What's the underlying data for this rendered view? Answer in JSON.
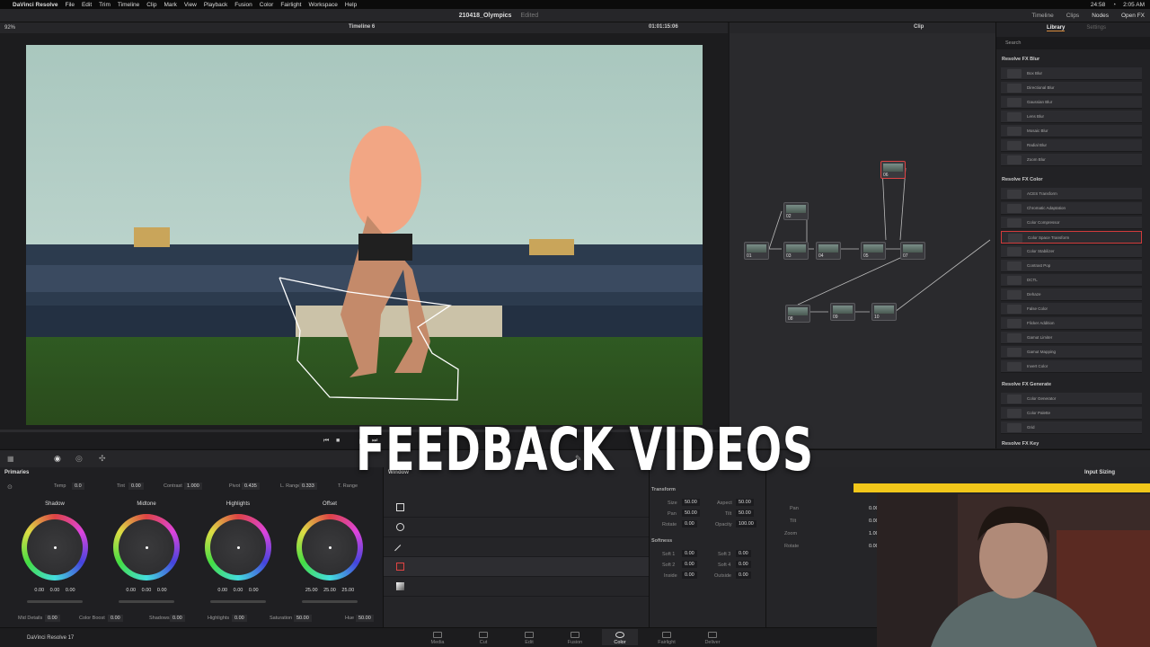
{
  "menubar": {
    "app_name": "DaVinci Resolve",
    "items": [
      "File",
      "Edit",
      "Trim",
      "Timeline",
      "Clip",
      "Mark",
      "View",
      "Playback",
      "Fusion",
      "Color",
      "Fairlight",
      "Workspace",
      "Help"
    ],
    "battery": "24:58",
    "clock": "2:05 AM"
  },
  "header": {
    "project_title": "210418_Olympics",
    "status": "Edited",
    "tabs": [
      "Timeline",
      "Clips",
      "Nodes",
      "Open FX"
    ]
  },
  "viewer": {
    "zoom": "92%",
    "timeline_name": "Timeline 6",
    "timecode": "01:01:15:06"
  },
  "nodes": {
    "mode": "Clip",
    "items": [
      "01",
      "02",
      "03",
      "04",
      "05",
      "06",
      "07",
      "08",
      "09",
      "10"
    ]
  },
  "library": {
    "tabs": [
      "Library",
      "Settings"
    ],
    "search_placeholder": "Search",
    "sections": [
      {
        "title": "Resolve FX Blur",
        "items": [
          "Box Blur",
          "Directional Blur",
          "Gaussian Blur",
          "Lens Blur",
          "Mosaic Blur",
          "Radial Blur",
          "Zoom Blur"
        ]
      },
      {
        "title": "Resolve FX Color",
        "items": [
          "ACES Transform",
          "Chromatic Adaptation",
          "Color Compressor",
          "Color Space Transform",
          "Color Stabilizer",
          "Contrast Pop",
          "DCTL",
          "Dehaze",
          "False Color",
          "Flicker Addition",
          "Gamut Limiter",
          "Gamut Mapping",
          "Invert Color"
        ]
      },
      {
        "title": "Resolve FX Generate",
        "items": [
          "Color Generator",
          "Color Palette",
          "Grid"
        ]
      },
      {
        "title": "Resolve FX Key",
        "items": []
      }
    ],
    "selected": "Color Space Transform"
  },
  "primaries": {
    "title": "Primaries",
    "params": [
      {
        "label": "Temp",
        "value": "0.0"
      },
      {
        "label": "Tint",
        "value": "0.00"
      },
      {
        "label": "Contrast",
        "value": "1.000"
      },
      {
        "label": "Pivot",
        "value": "0.435"
      },
      {
        "label": "L. Range",
        "value": "0.333"
      },
      {
        "label": "T. Range",
        "value": "0.55"
      }
    ],
    "wheels": [
      {
        "name": "Shadow",
        "values": "0.00 0.00 0.00"
      },
      {
        "name": "Midtone",
        "values": "0.00 0.00 0.00"
      },
      {
        "name": "Highlights",
        "values": "0.00 0.00 0.00"
      },
      {
        "name": "Offset",
        "values": "25.00 25.00 25.00"
      }
    ],
    "bottom": [
      {
        "label": "Mid Details",
        "value": "0.00"
      },
      {
        "label": "Color Boost",
        "value": "0.00"
      },
      {
        "label": "Shadows",
        "value": "0.00"
      },
      {
        "label": "Highlights",
        "value": "0.00"
      },
      {
        "label": "Saturation",
        "value": "50.00"
      },
      {
        "label": "Hue",
        "value": "50.00"
      }
    ]
  },
  "window_panel": {
    "title": "Window"
  },
  "transform": {
    "title": "Transform",
    "size": "50.00",
    "aspect": "50.00",
    "pan": "50.00",
    "tilt": "50.00",
    "rotate": "0.00",
    "opacity": "100.00",
    "softness_title": "Softness",
    "soft1": "0.00",
    "soft2": "0.00",
    "soft3": "0.00",
    "soft4": "0.00",
    "inside": "0.00",
    "outside": "0.00"
  },
  "sizing": {
    "title": "Input Sizing",
    "rows": [
      {
        "label": "Pan",
        "value": "0.00"
      },
      {
        "label": "Tilt",
        "value": "0.00"
      },
      {
        "label": "Zoom",
        "value": "1.00"
      },
      {
        "label": "Rotate",
        "value": "0.00"
      }
    ]
  },
  "pages": {
    "version": "DaVinci Resolve 17",
    "items": [
      "Media",
      "Cut",
      "Edit",
      "Fusion",
      "Color",
      "Fairlight",
      "Deliver"
    ],
    "active": "Color"
  },
  "overlay": {
    "title": "FEEDBACK VIDEOS"
  },
  "colors": {
    "accent": "#f2c71a",
    "selection": "#d13b3b",
    "panel": "#252528"
  }
}
